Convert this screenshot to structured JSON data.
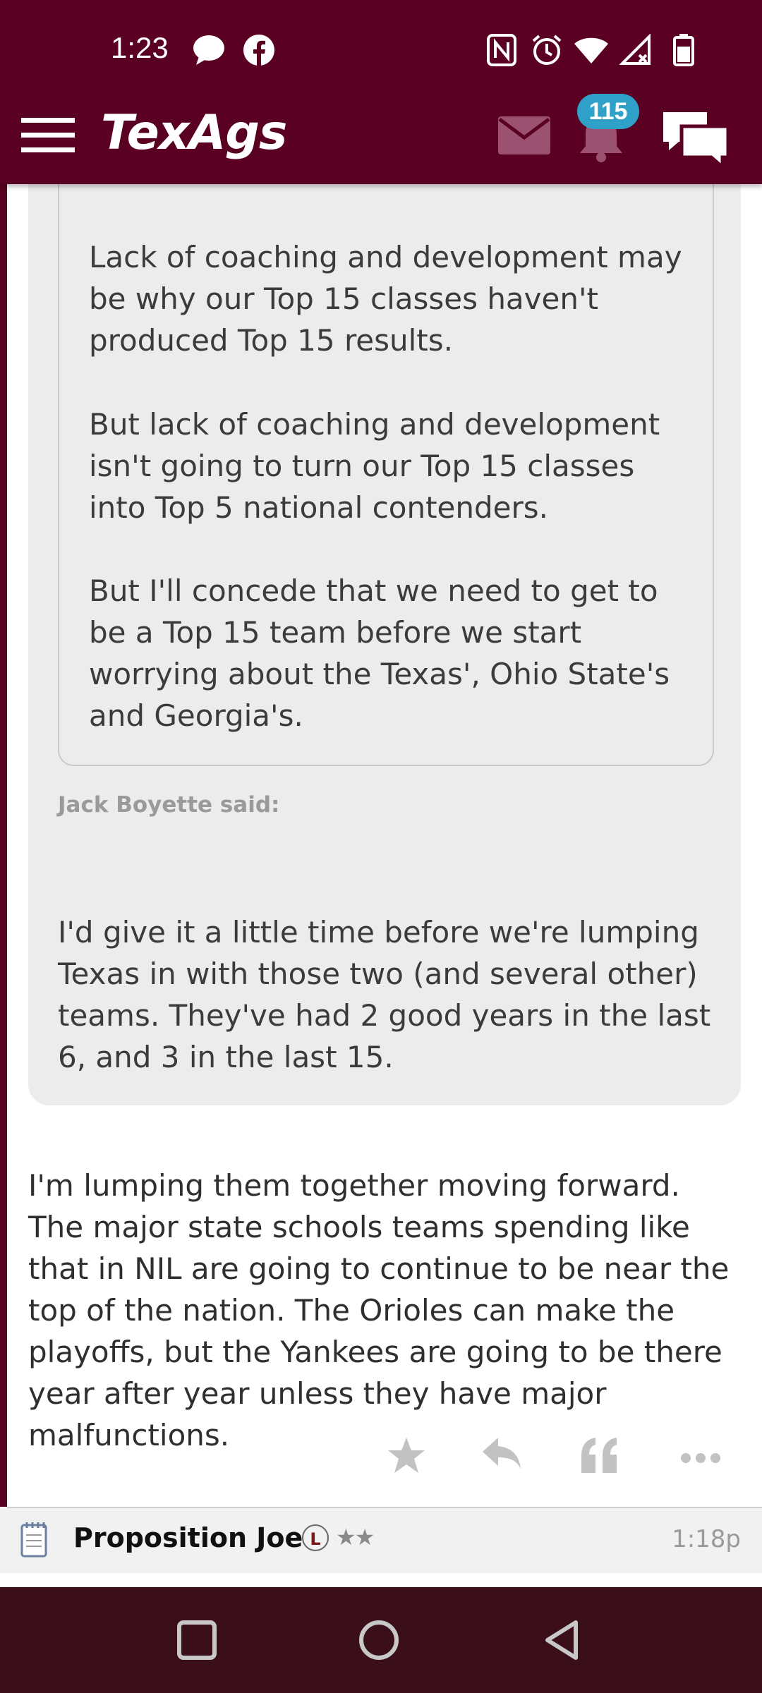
{
  "status_bar": {
    "time": "1:23",
    "icons": [
      "chat-bubble-icon",
      "facebook-icon",
      "nfc-icon",
      "alarm-icon",
      "wifi-icon",
      "signal-icon",
      "battery-icon"
    ]
  },
  "header": {
    "logo": "TexAgs",
    "notification_count": "115",
    "colors": {
      "maroon": "#5a0022",
      "badge": "#2fa1c8"
    }
  },
  "quote": {
    "nested_paragraphs": [
      "Lack of coaching and development may be why our Top 15 classes haven't produced Top 15 results.",
      "But lack of coaching and development isn't going to turn our Top 15 classes into Top 5 national contenders.",
      "But I'll concede that we need to get to be a Top 15 team before we start worrying about the Texas', Ohio State's and Georgia's."
    ],
    "author_said": "Jack Boyette said:",
    "text": "I'd give it a little time before we're lumping Texas in with those two (and several other) teams. They've had 2 good years in the last 6, and 3 in the last 15."
  },
  "post": {
    "body": "I'm lumping them together moving forward. The major state schools teams spending like that in NIL are going to continue to be near the top of the nation. The Orioles can make the playoffs, but the Yankees are going to be there year after year unless they have major malfunctions.",
    "actions": [
      "star-icon",
      "reply-icon",
      "quote-icon",
      "more-icon"
    ]
  },
  "next_post": {
    "username": "Proposition Joe",
    "badge_letter": "L",
    "stars": "★★",
    "time": "1:18p"
  }
}
